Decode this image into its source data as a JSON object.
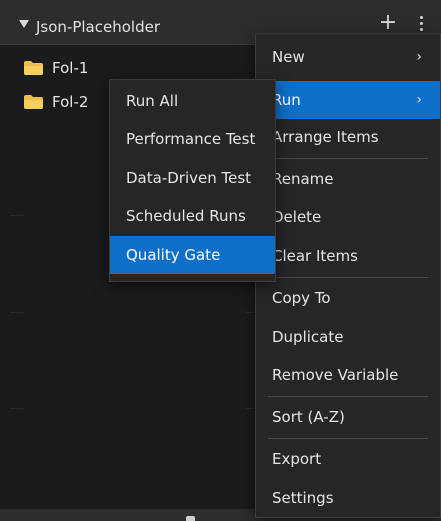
{
  "header": {
    "title": "Json-Placeholder"
  },
  "tree": {
    "items": [
      {
        "label": "Fol-1"
      },
      {
        "label": "Fol-2"
      }
    ]
  },
  "main_menu": {
    "items": [
      {
        "label": "New",
        "chevron": "›"
      },
      {
        "label": "Run",
        "chevron": "›"
      },
      {
        "label": "Arrange Items"
      },
      {
        "label": "Rename"
      },
      {
        "label": "Delete"
      },
      {
        "label": "Clear Items"
      },
      {
        "label": "Copy To"
      },
      {
        "label": "Duplicate"
      },
      {
        "label": "Remove Variable"
      },
      {
        "label": "Sort (A-Z)"
      },
      {
        "label": "Export"
      },
      {
        "label": "Settings"
      }
    ]
  },
  "run_submenu": {
    "items": [
      {
        "label": "Run All"
      },
      {
        "label": "Performance Test"
      },
      {
        "label": "Data-Driven Test"
      },
      {
        "label": "Scheduled Runs"
      },
      {
        "label": "Quality Gate"
      }
    ]
  },
  "icons": {
    "header_caret": "caret-down-icon",
    "add": "plus-icon",
    "more": "kebab-menu-icon",
    "folder": "folder-icon"
  },
  "colors": {
    "accent": "#0e6fc9",
    "folder": "#f2c04a",
    "background": "#1b1b1d",
    "menu_background": "#262629"
  }
}
